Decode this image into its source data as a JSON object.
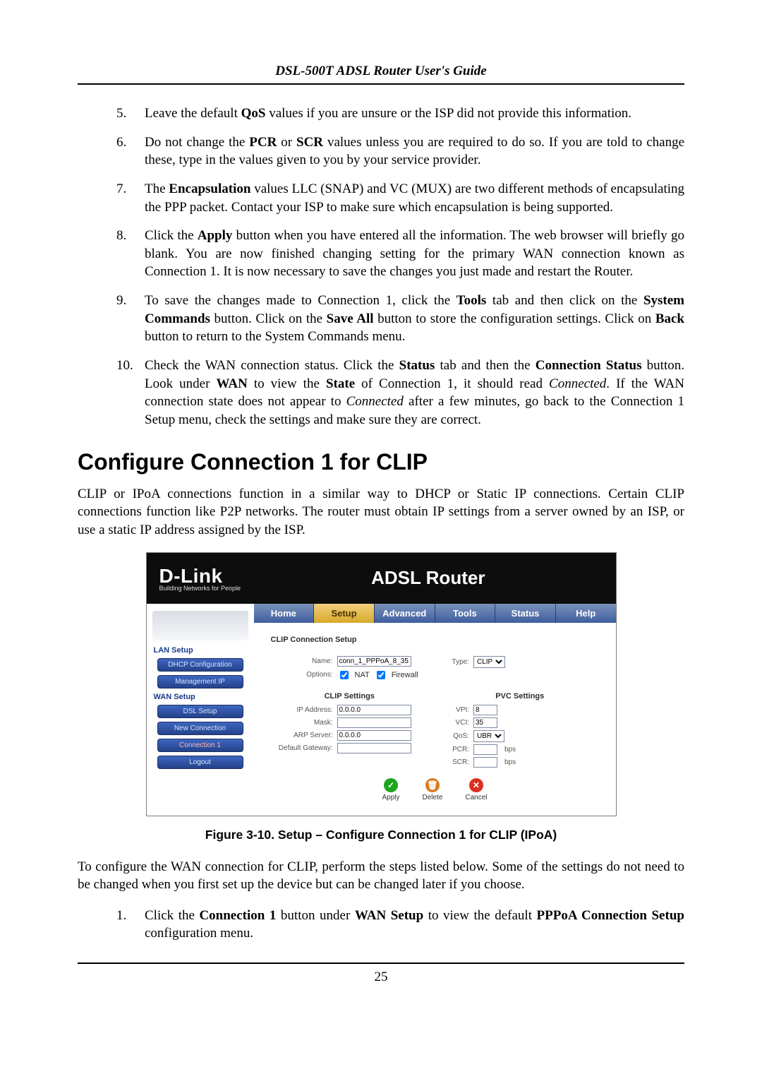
{
  "doc": {
    "header": "DSL-500T ADSL Router User's Guide",
    "page_number": "25"
  },
  "list_a": {
    "i5": {
      "num": "5.",
      "pre": "Leave the default ",
      "b1": "QoS",
      "post": " values if you are unsure or the ISP did not provide this information."
    },
    "i6": {
      "num": "6.",
      "pre": "Do not change the ",
      "b1": "PCR",
      "mid1": " or ",
      "b2": "SCR",
      "post": " values unless you are required to do so. If you are told to change these, type in the values given to you by your service provider."
    },
    "i7": {
      "num": "7.",
      "pre": "The ",
      "b1": "Encapsulation",
      "post": " values LLC (SNAP) and VC (MUX) are two different methods of encapsulating the PPP packet. Contact your ISP to make sure which encapsulation is being supported."
    },
    "i8": {
      "num": "8.",
      "pre": "Click the ",
      "b1": "Apply",
      "post": " button when you have entered all the information. The web browser will briefly go blank. You are now finished changing setting for the primary WAN connection known as Connection 1. It is now necessary to save the changes you just made and restart the Router."
    },
    "i9": {
      "num": "9.",
      "pre": "To save the changes made to Connection 1, click the ",
      "b1": "Tools",
      "mid1": " tab and then click on the ",
      "b2": "System Commands",
      "mid2": " button. Click on the ",
      "b3": "Save All",
      "mid3": " button to store the configuration settings. Click on ",
      "b4": "Back",
      "post": " button to return to the System Commands menu."
    },
    "i10": {
      "num": "10.",
      "pre": "Check the WAN connection status. Click the ",
      "b1": "Status",
      "mid1": " tab and then the ",
      "b2": "Connection Status",
      "mid2": " button. Look under ",
      "b3": "WAN",
      "mid3": " to view the ",
      "b4": "State",
      "mid4": " of Connection 1, it should read ",
      "em1": "Connected",
      "mid5": ". If the WAN connection state does not appear to ",
      "em2": "Connected",
      "post": " after a few minutes, go back to the Connection 1 Setup menu, check the settings and make sure they are correct."
    }
  },
  "section": {
    "title": "Configure Connection 1 for CLIP",
    "intro": "CLIP or IPoA connections function in a similar way to DHCP or Static IP connections. Certain CLIP connections function like P2P networks. The router must obtain IP settings from a server owned by an ISP, or use a static IP address assigned by the ISP."
  },
  "router": {
    "brand": "D-Link",
    "tagline": "Building Networks for People",
    "title": "ADSL Router",
    "tabs": {
      "home": "Home",
      "setup": "Setup",
      "advanced": "Advanced",
      "tools": "Tools",
      "status": "Status",
      "help": "Help"
    },
    "side": {
      "lan": "LAN Setup",
      "dhcp": "DHCP Configuration",
      "mgmt": "Management IP",
      "wan": "WAN Setup",
      "dsl": "DSL Setup",
      "newc": "New Connection",
      "conn1": "Connection 1",
      "logout": "Logout"
    },
    "panel": {
      "title": "CLIP Connection Setup",
      "name_l": "Name:",
      "name_v": "conn_1_PPPoA_8_35",
      "type_l": "Type:",
      "type_v": "CLIP",
      "opt_l": "Options:",
      "nat": "NAT",
      "fw": "Firewall",
      "clip_title": "CLIP Settings",
      "ip_l": "IP Address:",
      "ip_v": "0.0.0.0",
      "mask_l": "Mask:",
      "mask_v": "",
      "arp_l": "ARP Server:",
      "arp_v": "0.0.0.0",
      "gw_l": "Default Gateway:",
      "gw_v": "",
      "pvc_title": "PVC Settings",
      "vpi_l": "VPI:",
      "vpi_v": "8",
      "vci_l": "VCI:",
      "vci_v": "35",
      "qos_l": "QoS:",
      "qos_v": "UBR",
      "pcr_l": "PCR:",
      "pcr_v": "",
      "pcr_u": "bps",
      "scr_l": "SCR:",
      "scr_v": "",
      "scr_u": "bps",
      "apply": "Apply",
      "delete": "Delete",
      "cancel": "Cancel"
    }
  },
  "figure_caption": "Figure 3-10. Setup – Configure Connection 1 for CLIP (IPoA)",
  "post_fig": {
    "p": "To configure the WAN connection for CLIP, perform the steps listed below. Some of the settings do not need to be changed when you first set up the device but can be changed later if you choose.",
    "li1": {
      "num": "1.",
      "pre": "Click the ",
      "b1": "Connection 1",
      "mid1": " button under ",
      "b2": "WAN Setup",
      "mid2": " to view the default ",
      "b3": "PPPoA Connection Setup",
      "post": " configuration menu."
    }
  }
}
